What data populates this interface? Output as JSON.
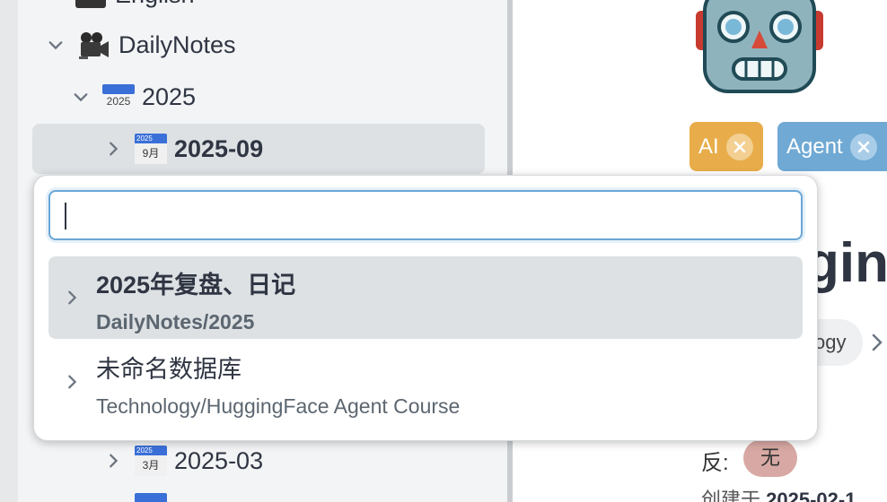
{
  "sidebar": {
    "items": [
      {
        "label": "English",
        "icon": "document-icon",
        "expanded": true
      },
      {
        "label": "DailyNotes",
        "icon": "movie-camera-icon",
        "expanded": true
      },
      {
        "label": "2025",
        "icon": "calendar-year-icon",
        "icon_text": "2025",
        "expanded": true
      },
      {
        "label": "2025-09",
        "icon": "calendar-icon",
        "icon_year": "2025",
        "icon_month": "9月",
        "expanded": false,
        "selected": true
      },
      {
        "label": "2025-03",
        "icon": "calendar-icon",
        "icon_year": "2025",
        "icon_month": "3月",
        "expanded": false
      }
    ]
  },
  "main": {
    "tags": [
      {
        "label": "AI",
        "color": "#e8ad4a"
      },
      {
        "label": "Agent",
        "color": "#6fa9d4"
      }
    ],
    "title_partial": "gin",
    "breadcrumb_partial": "ogy",
    "fan_label": "反:",
    "none_badge": "无",
    "created_label": "创建于",
    "created_value": "2025-02-1"
  },
  "popup": {
    "search": {
      "value": "",
      "placeholder": ""
    },
    "results": [
      {
        "title": "2025年复盘、日记",
        "path": "DailyNotes/2025",
        "highlighted": true
      },
      {
        "title": "未命名数据库",
        "path": "Technology/HuggingFace Agent Course",
        "highlighted": false
      }
    ]
  }
}
